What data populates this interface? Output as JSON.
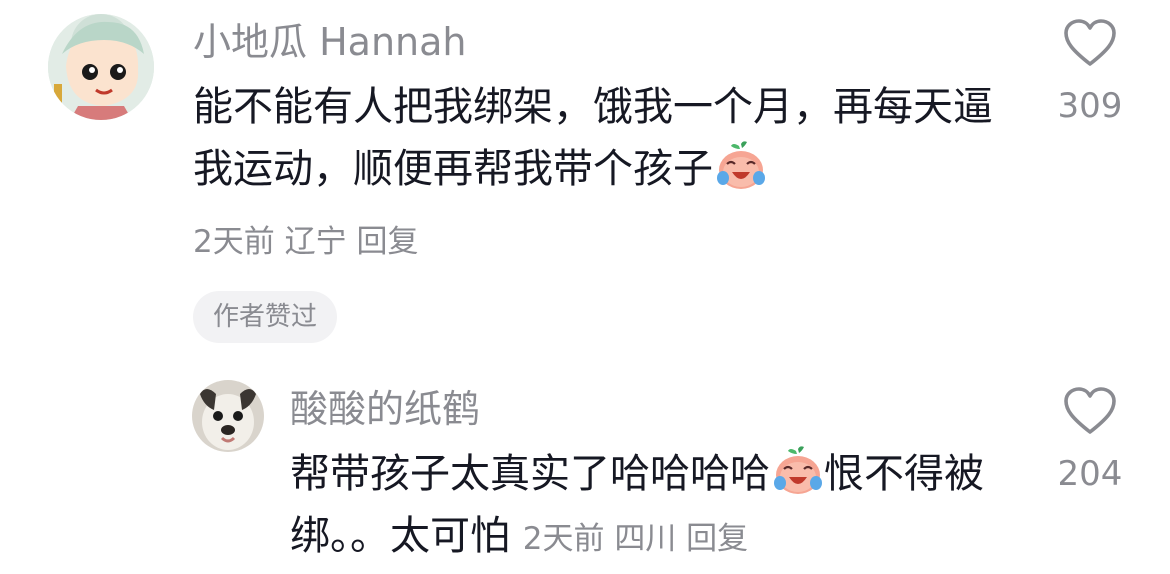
{
  "comment": {
    "username": "小地瓜 Hannah",
    "content": "能不能有人把我绑架，饿我一个月，再每天逼我运动，顺便再帮我带个孩子",
    "time": "2天前",
    "location": "辽宁",
    "reply_label": "回复",
    "likes": "309",
    "author_badge": "作者赞过",
    "emoji_icon": "crying-laughing-emoji-icon"
  },
  "reply": {
    "username": "酸酸的纸鹤",
    "content": "帮带孩子太真实了哈哈哈哈",
    "content_after_emoji": "恨不得被绑。。太可怕",
    "time": "2天前",
    "location": "四川",
    "reply_label": "回复",
    "likes": "204",
    "emoji_icon": "crying-laughing-emoji-icon"
  },
  "colors": {
    "text_primary": "#161823",
    "text_secondary": "#8a8b91",
    "badge_bg": "#f2f2f4"
  }
}
